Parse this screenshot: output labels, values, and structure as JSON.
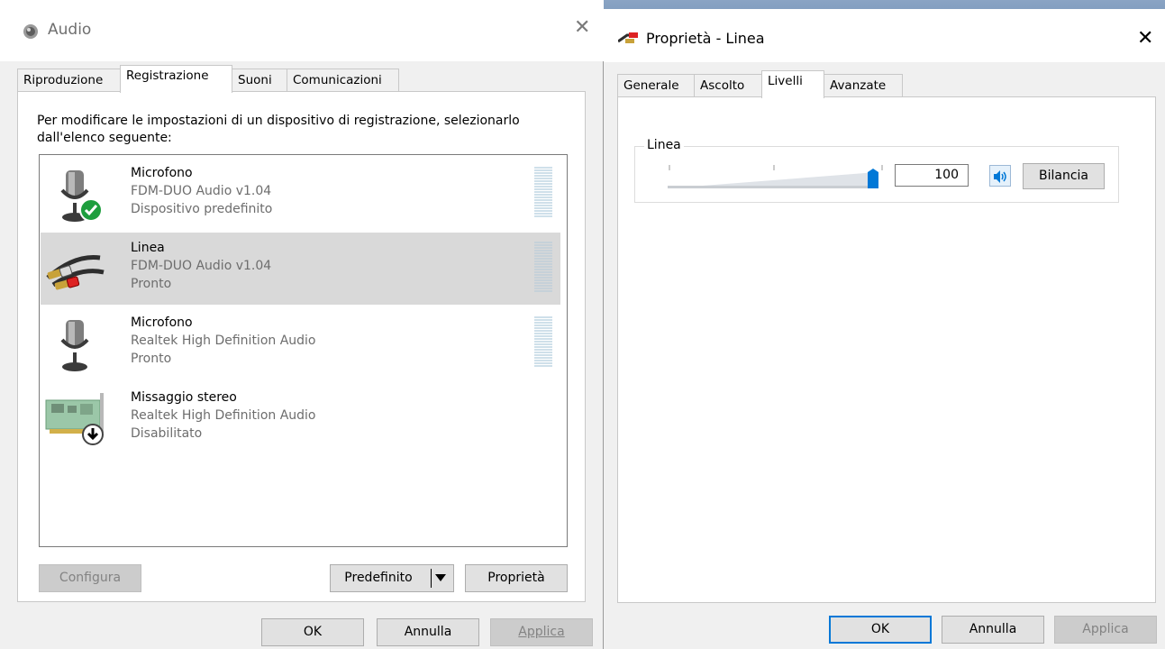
{
  "audio_dialog": {
    "title": "Audio",
    "tabs": [
      {
        "label": "Riproduzione",
        "active": false
      },
      {
        "label": "Registrazione",
        "active": true
      },
      {
        "label": "Suoni",
        "active": false
      },
      {
        "label": "Comunicazioni",
        "active": false
      }
    ],
    "instruction": "Per modificare le impostazioni di un dispositivo di registrazione, selezionarlo dall'elenco seguente:",
    "devices": [
      {
        "name": "Microfono",
        "description": "FDM-DUO Audio v1.04",
        "status": "Dispositivo predefinito",
        "icon": "microphone-default-icon",
        "selected": false
      },
      {
        "name": "Linea",
        "description": "FDM-DUO Audio v1.04",
        "status": "Pronto",
        "icon": "line-in-cable-icon",
        "selected": true
      },
      {
        "name": "Microfono",
        "description": "Realtek High Definition Audio",
        "status": "Pronto",
        "icon": "microphone-icon",
        "selected": false
      },
      {
        "name": "Missaggio stereo",
        "description": "Realtek High Definition Audio",
        "status": "Disabilitato",
        "icon": "sound-card-disabled-icon",
        "selected": false
      }
    ],
    "buttons": {
      "configure": "Configura",
      "default": "Predefinito",
      "properties": "Proprietà",
      "ok": "OK",
      "cancel": "Annulla",
      "apply": "Applica"
    }
  },
  "properties_dialog": {
    "title": "Proprietà - Linea",
    "tabs": [
      {
        "label": "Generale",
        "active": false
      },
      {
        "label": "Ascolto",
        "active": false
      },
      {
        "label": "Livelli",
        "active": true
      },
      {
        "label": "Avanzate",
        "active": false
      }
    ],
    "level": {
      "label": "Linea",
      "value": "100",
      "slider_percent": 100,
      "balance_label": "Bilancia"
    },
    "buttons": {
      "ok": "OK",
      "cancel": "Annulla",
      "apply": "Applica"
    }
  },
  "colors": {
    "accent": "#0078d7",
    "selection": "#d9d9d9",
    "check_green": "#1e9e3e"
  }
}
